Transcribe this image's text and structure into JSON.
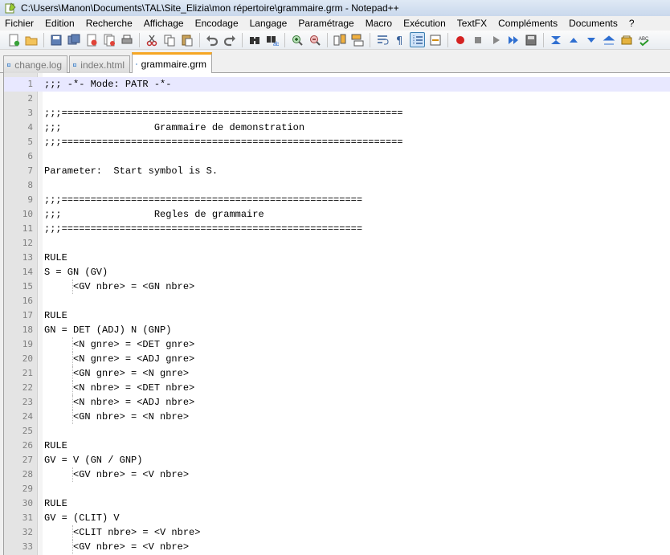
{
  "window": {
    "title": "C:\\Users\\Manon\\Documents\\TAL\\Site_Elizia\\mon répertoire\\grammaire.grm - Notepad++"
  },
  "menu": [
    "Fichier",
    "Edition",
    "Recherche",
    "Affichage",
    "Encodage",
    "Langage",
    "Paramétrage",
    "Macro",
    "Exécution",
    "TextFX",
    "Compléments",
    "Documents",
    "?"
  ],
  "toolbar": {
    "icons": [
      "new-file-icon",
      "open-file-icon",
      "save-icon",
      "save-all-icon",
      "close-icon",
      "close-all-icon",
      "print-icon",
      "cut-icon",
      "copy-icon",
      "paste-icon",
      "undo-icon",
      "redo-icon",
      "find-icon",
      "replace-icon",
      "zoom-in-icon",
      "zoom-out-icon",
      "sync-vertical-icon",
      "sync-horizontal-icon",
      "word-wrap-icon",
      "show-all-chars-icon",
      "indent-guide-icon",
      "user-defined-lang-icon",
      "record-macro-icon",
      "stop-record-icon",
      "play-macro-icon",
      "run-multiple-macro-icon",
      "save-macro-icon",
      "fold-icon",
      "up-arrow-icon",
      "down-arrow-icon",
      "unfold-icon",
      "textfx-tool-icon",
      "spellcheck-icon"
    ],
    "active": "indent-guide-icon"
  },
  "tabs": [
    {
      "label": "change.log",
      "active": false
    },
    {
      "label": "index.html",
      "active": false
    },
    {
      "label": "grammaire.grm",
      "active": true
    }
  ],
  "editor": {
    "current_line": 1,
    "lines": [
      ";;; -*- Mode: PATR -*-",
      "",
      ";;;===========================================================",
      ";;;                Grammaire de demonstration",
      ";;;===========================================================",
      "",
      "Parameter:  Start symbol is S.",
      "",
      ";;;====================================================",
      ";;;                Regles de grammaire",
      ";;;====================================================",
      "",
      "RULE",
      "S = GN (GV)",
      "     <GV nbre> = <GN nbre>",
      "",
      "RULE",
      "GN = DET (ADJ) N (GNP)",
      "     <N gnre> = <DET gnre>",
      "     <N gnre> = <ADJ gnre>",
      "     <GN gnre> = <N gnre>",
      "     <N nbre> = <DET nbre>",
      "     <N nbre> = <ADJ nbre>",
      "     <GN nbre> = <N nbre>",
      "",
      "RULE",
      "GV = V (GN / GNP)",
      "     <GV nbre> = <V nbre>",
      "",
      "RULE",
      "GV = (CLIT) V",
      "     <CLIT nbre> = <V nbre>",
      "     <GV nbre> = <V nbre>"
    ]
  }
}
